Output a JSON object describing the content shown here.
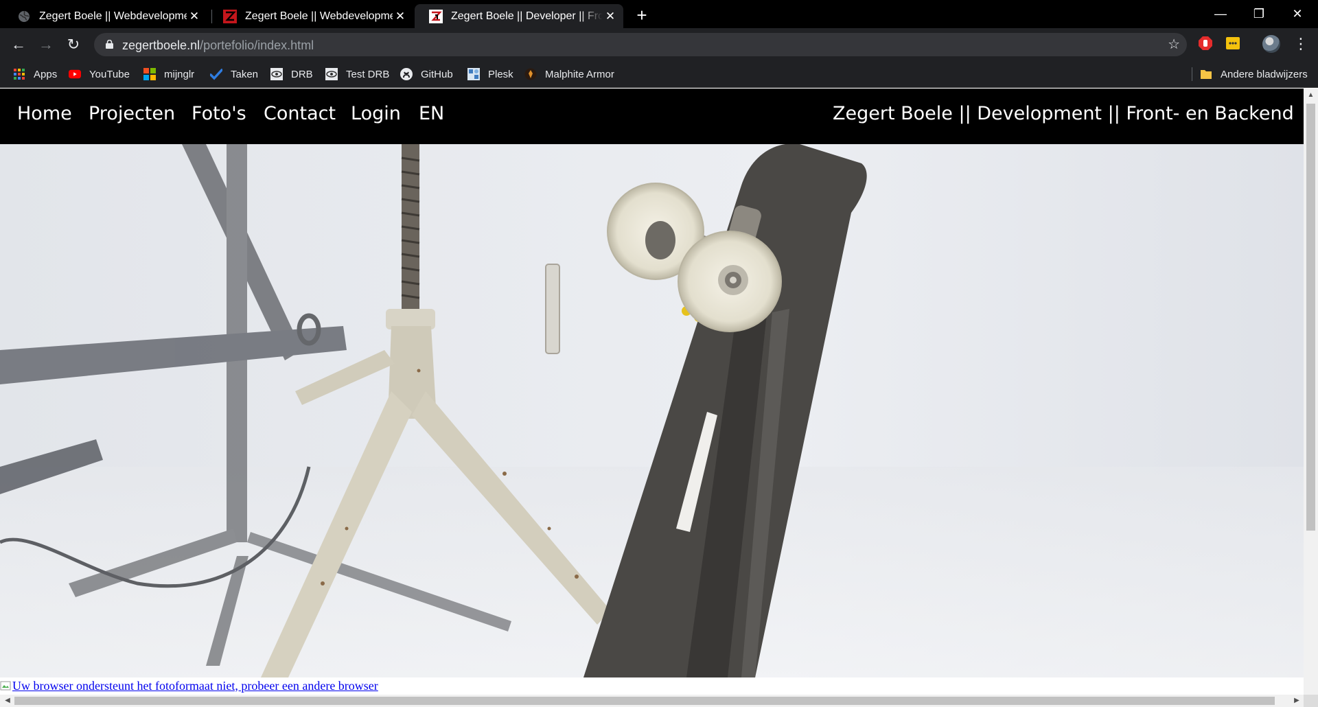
{
  "browser": {
    "tabs": [
      {
        "title": "Zegert Boele || Webdevelopment",
        "favicon": "globe-icon",
        "active": false
      },
      {
        "title": "Zegert Boele || Webdevelopment",
        "favicon": "zb-logo-icon",
        "active": false
      },
      {
        "title": "Zegert Boele || Developer || Front- en Backend",
        "favicon": "zb-logo-icon",
        "active": true
      }
    ],
    "new_tab": "+",
    "window_controls": {
      "minimize": "—",
      "restore": "❐",
      "close": "✕"
    },
    "toolbar": {
      "back": "←",
      "forward": "→",
      "reload": "↻",
      "url_domain": "zegertboele.nl",
      "url_path": "/portefolio/index.html",
      "bookmark_star": "☆",
      "menu": "⋮"
    },
    "bookmarks": [
      {
        "label": "Apps",
        "icon": "apps-grid-icon"
      },
      {
        "label": "YouTube",
        "icon": "youtube-icon"
      },
      {
        "label": "mijnglr",
        "icon": "windows-logo-icon"
      },
      {
        "label": "Taken",
        "icon": "checkmark-icon"
      },
      {
        "label": "DRB",
        "icon": "eye-icon"
      },
      {
        "label": "Test DRB",
        "icon": "eye-icon"
      },
      {
        "label": "GitHub",
        "icon": "github-icon"
      },
      {
        "label": "Plesk",
        "icon": "plesk-icon"
      },
      {
        "label": "Malphite Armor",
        "icon": "game-icon"
      }
    ],
    "other_bookmarks": "Andere bladwijzers"
  },
  "site": {
    "nav": [
      "Home",
      "Projecten",
      "Foto's",
      "Contact",
      "Login",
      "EN"
    ],
    "brand": "Zegert Boele || Development || Front- en Backend",
    "hero_alt_link": "Uw browser ondersteunt het fotoformaat niet, probeer een andere browser"
  },
  "colors": {
    "chrome_dark": "#202124",
    "tabbar": "#000000",
    "site_nav": "#000000",
    "link": "#0000ee",
    "youtube_red": "#ff0000"
  }
}
